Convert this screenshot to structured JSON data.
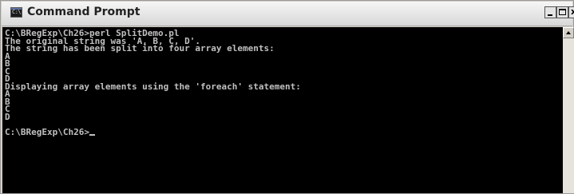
{
  "window": {
    "title": "Command Prompt",
    "icon": "command-prompt-icon",
    "icon_text": "C:\\"
  },
  "controls": {
    "minimize_icon": "minimize-icon",
    "maximize_icon": "maximize-icon",
    "close_glyph": "x"
  },
  "console": {
    "background": "#000000",
    "foreground": "#c0c0c0",
    "lines": [
      "C:\\BRegExp\\Ch26>perl SplitDemo.pl",
      "The original string was 'A, B, C, D'.",
      "The string has been split into four array elements:",
      "A",
      "B",
      "C",
      "D",
      "Displaying array elements using the 'foreach' statement:",
      "A",
      "B",
      "C",
      "D",
      "",
      "C:\\BRegExp\\Ch26>"
    ]
  },
  "scrollbar": {
    "up_icon": "scroll-up-arrow-icon"
  }
}
